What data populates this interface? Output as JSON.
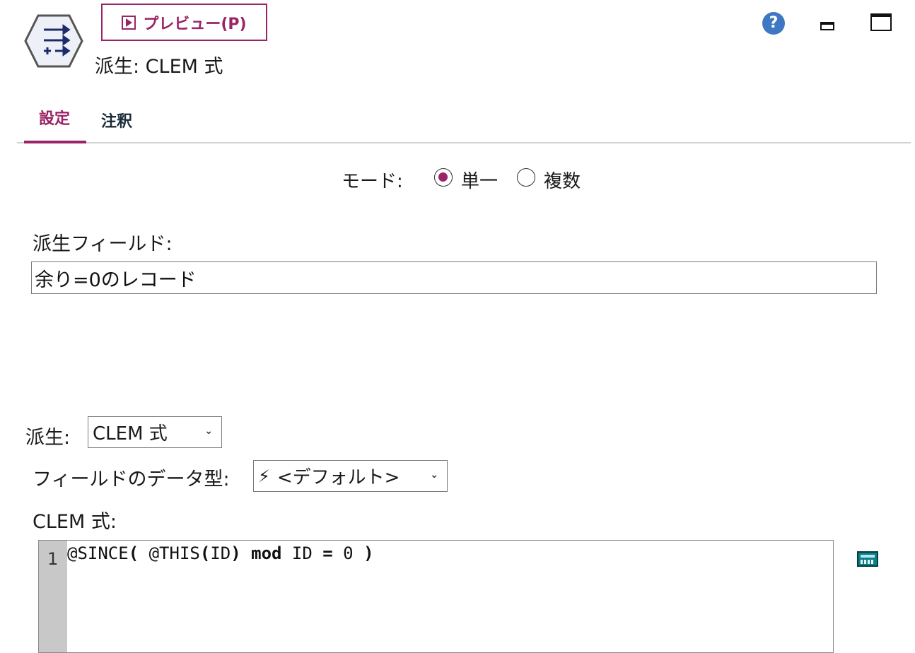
{
  "header": {
    "preview_label": "プレビュー(P)",
    "node_title": "派生: CLEM 式",
    "help_symbol": "?"
  },
  "tabs": [
    {
      "label": "設定",
      "active": true
    },
    {
      "label": "注釈",
      "active": false
    }
  ],
  "mode": {
    "label": "モード:",
    "options": [
      "単一",
      "複数"
    ],
    "selected": "単一"
  },
  "derive_field": {
    "label": "派生フィールド:",
    "value": "余り=0のレコード"
  },
  "derive": {
    "label": "派生:",
    "value": "CLEM 式"
  },
  "field_type": {
    "label": "フィールドのデータ型:",
    "value": "<デフォルト>"
  },
  "clem": {
    "label": "CLEM 式:",
    "line_number": "1",
    "code_parts": [
      "@SINCE",
      "(",
      " @THIS",
      "(",
      "ID",
      ")",
      " ",
      "mod",
      " ID ",
      "=",
      " 0 ",
      ")"
    ]
  },
  "colors": {
    "accent": "#9b2466",
    "help": "#3e78c2"
  }
}
